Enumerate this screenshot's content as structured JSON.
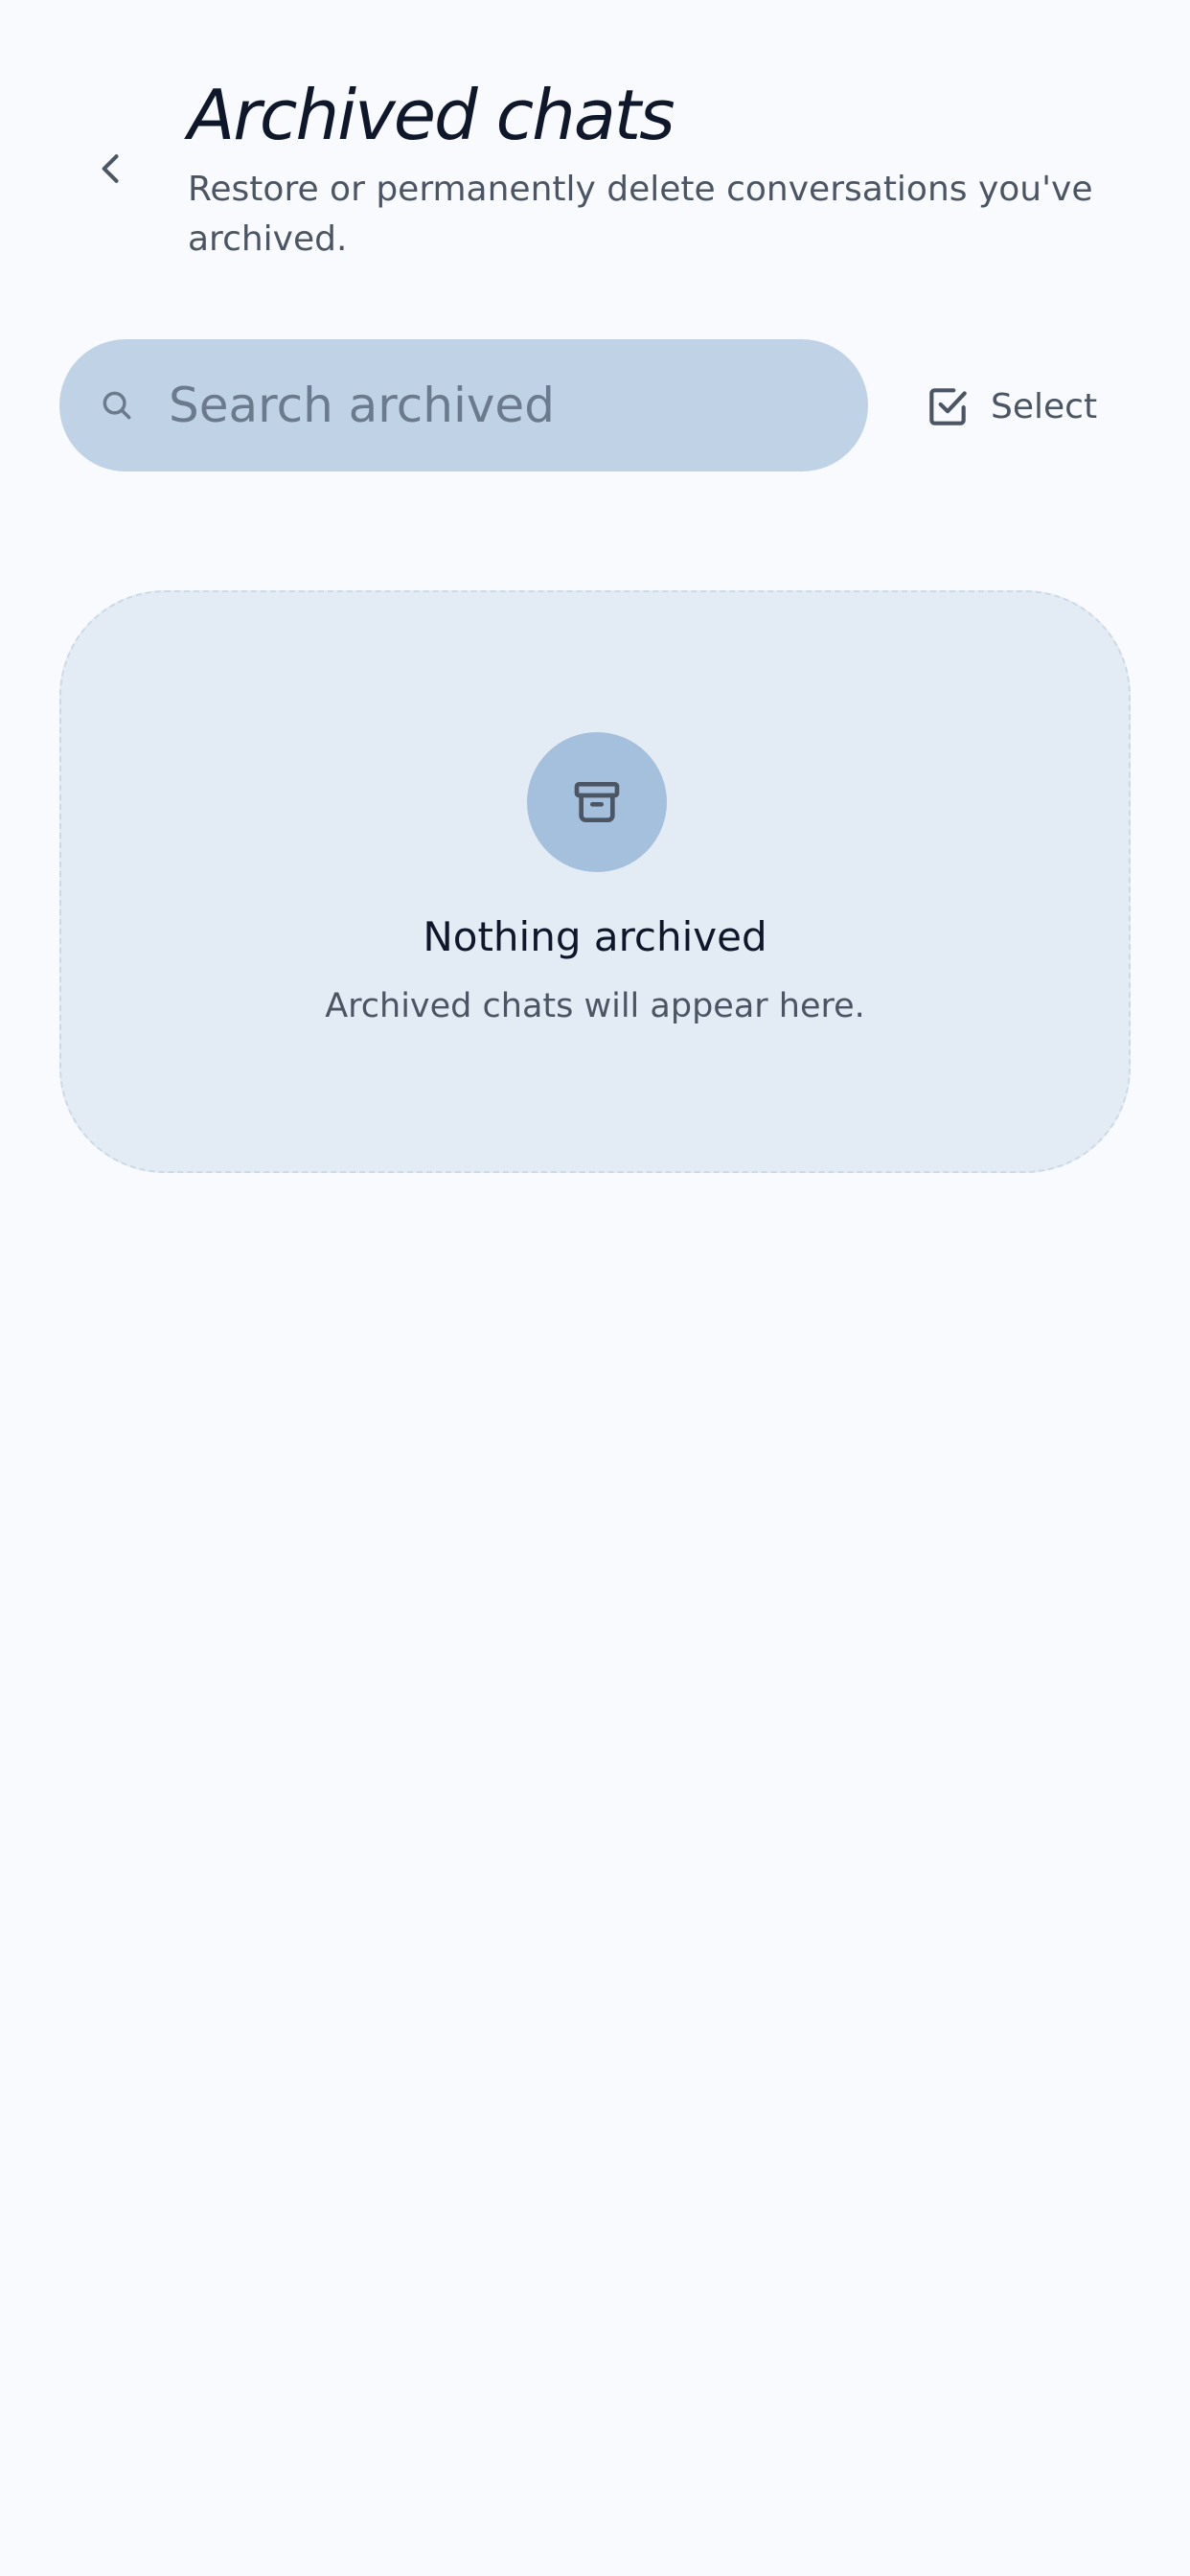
{
  "header": {
    "title": "Archived chats",
    "subtitle": "Restore or permanently delete conversations you've archived.",
    "back_icon": "chevron-left-icon"
  },
  "search": {
    "placeholder": "Search archived",
    "value": "",
    "icon": "search-icon"
  },
  "select_button": {
    "label": "Select",
    "icon": "checkbox-checked-icon"
  },
  "empty_state": {
    "icon": "archive-box-icon",
    "title": "Nothing archived",
    "message": "Archived chats will appear here."
  },
  "colors": {
    "background": "#f8fafd",
    "search_bar": "#c0d3e6",
    "card_background": "#e3ecf5",
    "icon_circle": "#a5c0dd",
    "text_primary": "#0f172a",
    "text_secondary": "#4b5563"
  }
}
